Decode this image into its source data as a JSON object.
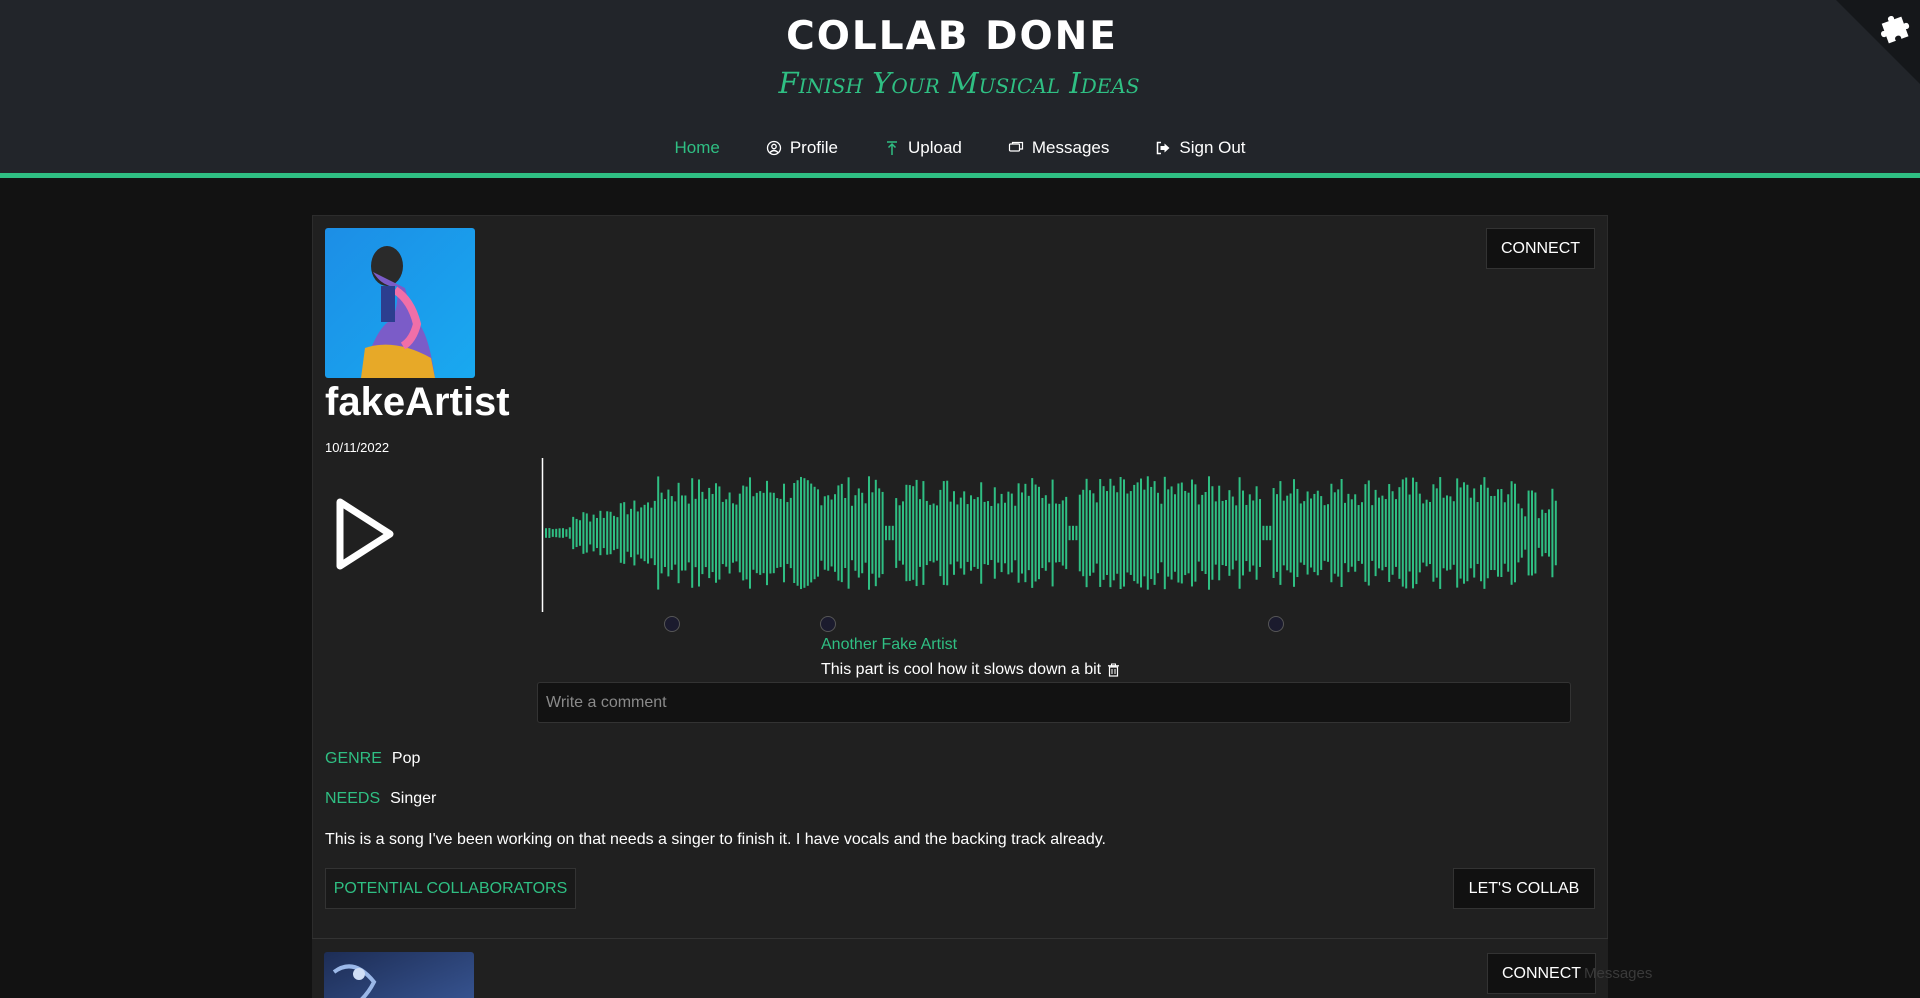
{
  "site": {
    "title": "COLLAB DONE",
    "tagline": "Finish Your Musical Ideas"
  },
  "nav": {
    "home": "Home",
    "profile": "Profile",
    "upload": "Upload",
    "messages": "Messages",
    "signout": "Sign Out"
  },
  "post": {
    "username": "fakeArtist",
    "date": "10/11/2022",
    "connect_label": "CONNECT",
    "comment": {
      "author": "Another Fake Artist",
      "text": "This part is cool how it slows down a bit"
    },
    "comment_placeholder": "Write a comment",
    "genre_label": "GENRE",
    "genre": "Pop",
    "needs_label": "NEEDS",
    "needs": "Singer",
    "description": "This is a song I've been working on that needs a singer to finish it. I have vocals and the backing track already.",
    "collaborators_label": "POTENTIAL COLLABORATORS",
    "letscollab_label": "LET'S COLLAB"
  },
  "post2": {
    "connect_label": "CONNECT"
  },
  "ghost_messages": "Messages",
  "colors": {
    "accent": "#2fbf83",
    "header_bg": "#22252a",
    "page_bg": "#121212",
    "card_bg": "#202020"
  },
  "icons": [
    "user-circle-icon",
    "upload-icon",
    "messages-icon",
    "sign-out-icon",
    "play-icon",
    "trash-icon",
    "puzzle-piece-icon"
  ]
}
